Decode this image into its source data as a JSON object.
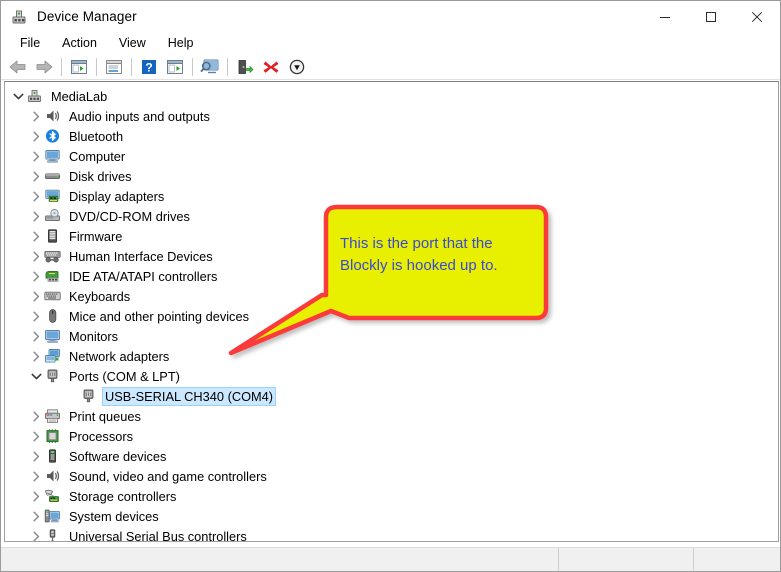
{
  "window": {
    "title": "Device Manager",
    "icon": "device-manager-icon",
    "controls": {
      "minimize": "Minimize",
      "maximize": "Maximize",
      "close": "Close"
    }
  },
  "menubar": {
    "items": [
      {
        "label": "File",
        "name": "menu-file"
      },
      {
        "label": "Action",
        "name": "menu-action"
      },
      {
        "label": "View",
        "name": "menu-view"
      },
      {
        "label": "Help",
        "name": "menu-help"
      }
    ]
  },
  "toolbar": {
    "buttons": [
      {
        "name": "back-button",
        "icon": "back-arrow-icon",
        "tooltip": "Back"
      },
      {
        "name": "forward-button",
        "icon": "forward-arrow-icon",
        "tooltip": "Forward"
      },
      {
        "name": "show-hide-console-tree-button",
        "icon": "console-tree-icon",
        "tooltip": "Show/Hide Console Tree"
      },
      {
        "name": "properties-button",
        "icon": "properties-icon",
        "tooltip": "Properties"
      },
      {
        "name": "help-button",
        "icon": "help-question-icon",
        "tooltip": "Help"
      },
      {
        "name": "show-hide-action-pane-button",
        "icon": "action-pane-icon",
        "tooltip": "Show/Hide Action Pane"
      },
      {
        "name": "scan-for-hardware-changes-button",
        "icon": "scan-monitor-icon",
        "tooltip": "Scan for hardware changes"
      },
      {
        "name": "update-driver-button",
        "icon": "update-driver-icon",
        "tooltip": "Update Driver Software"
      },
      {
        "name": "uninstall-device-button",
        "icon": "red-x-icon",
        "tooltip": "Uninstall device"
      },
      {
        "name": "disable-device-button",
        "icon": "down-arrow-circle-icon",
        "tooltip": "Disable device"
      }
    ]
  },
  "tree": {
    "nodes": [
      {
        "label": "MediaLab",
        "level": 0,
        "expander": "down",
        "icon": "computer-node-icon",
        "selected": false
      },
      {
        "label": "Audio inputs and outputs",
        "level": 1,
        "expander": "right",
        "icon": "speaker-icon",
        "selected": false
      },
      {
        "label": "Bluetooth",
        "level": 1,
        "expander": "right",
        "icon": "bluetooth-icon",
        "selected": false
      },
      {
        "label": "Computer",
        "level": 1,
        "expander": "right",
        "icon": "computer-icon",
        "selected": false
      },
      {
        "label": "Disk drives",
        "level": 1,
        "expander": "right",
        "icon": "disk-drive-icon",
        "selected": false
      },
      {
        "label": "Display adapters",
        "level": 1,
        "expander": "right",
        "icon": "display-adapter-icon",
        "selected": false
      },
      {
        "label": "DVD/CD-ROM drives",
        "level": 1,
        "expander": "right",
        "icon": "dvd-drive-icon",
        "selected": false
      },
      {
        "label": "Firmware",
        "level": 1,
        "expander": "right",
        "icon": "firmware-icon",
        "selected": false
      },
      {
        "label": "Human Interface Devices",
        "level": 1,
        "expander": "right",
        "icon": "hid-icon",
        "selected": false
      },
      {
        "label": "IDE ATA/ATAPI controllers",
        "level": 1,
        "expander": "right",
        "icon": "ide-controller-icon",
        "selected": false
      },
      {
        "label": "Keyboards",
        "level": 1,
        "expander": "right",
        "icon": "keyboard-icon",
        "selected": false
      },
      {
        "label": "Mice and other pointing devices",
        "level": 1,
        "expander": "right",
        "icon": "mouse-icon",
        "selected": false
      },
      {
        "label": "Monitors",
        "level": 1,
        "expander": "right",
        "icon": "monitor-icon",
        "selected": false
      },
      {
        "label": "Network adapters",
        "level": 1,
        "expander": "right",
        "icon": "network-adapter-icon",
        "selected": false
      },
      {
        "label": "Ports (COM & LPT)",
        "level": 1,
        "expander": "down",
        "icon": "port-icon",
        "selected": false
      },
      {
        "label": "USB-SERIAL CH340 (COM4)",
        "level": 2,
        "expander": "none",
        "icon": "port-icon",
        "selected": true
      },
      {
        "label": "Print queues",
        "level": 1,
        "expander": "right",
        "icon": "printer-icon",
        "selected": false
      },
      {
        "label": "Processors",
        "level": 1,
        "expander": "right",
        "icon": "processor-icon",
        "selected": false
      },
      {
        "label": "Software devices",
        "level": 1,
        "expander": "right",
        "icon": "software-device-icon",
        "selected": false
      },
      {
        "label": "Sound, video and game controllers",
        "level": 1,
        "expander": "right",
        "icon": "sound-controller-icon",
        "selected": false
      },
      {
        "label": "Storage controllers",
        "level": 1,
        "expander": "right",
        "icon": "storage-controller-icon",
        "selected": false
      },
      {
        "label": "System devices",
        "level": 1,
        "expander": "right",
        "icon": "system-device-icon",
        "selected": false
      },
      {
        "label": "Universal Serial Bus controllers",
        "level": 1,
        "expander": "right",
        "icon": "usb-controller-icon",
        "selected": false
      }
    ]
  },
  "statusbar": {
    "cells": [
      "",
      "",
      ""
    ]
  },
  "callout": {
    "text": "This is the port that the\nBlockly is hooked up to.",
    "fill_color": "#e8f000",
    "border_color": "#fb3a3a",
    "text_color": "#3a48d8"
  }
}
